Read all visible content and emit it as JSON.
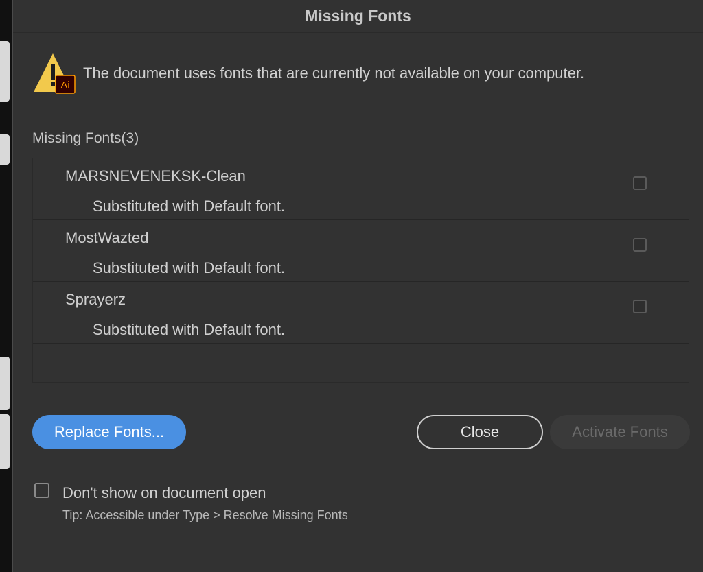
{
  "dialog": {
    "title": "Missing Fonts",
    "message": "The document uses fonts that are currently not available on your computer.",
    "warning_icon": "warning-triangle-with-ai-badge",
    "ai_badge": "Ai"
  },
  "fonts_list": {
    "title": "Missing Fonts(3)",
    "items": [
      {
        "name": "MARSNEVENEKSK-Clean",
        "status": "Substituted with Default font.",
        "checked": false
      },
      {
        "name": "MostWazted",
        "status": "Substituted with Default font.",
        "checked": false
      },
      {
        "name": "Sprayerz",
        "status": "Substituted with Default font.",
        "checked": false
      }
    ]
  },
  "buttons": {
    "replace": "Replace Fonts...",
    "close": "Close",
    "activate": "Activate Fonts"
  },
  "footer": {
    "checkbox_label": "Don't show on document open",
    "tip": "Tip: Accessible under Type > Resolve Missing Fonts"
  },
  "colors": {
    "dialog_bg": "#323232",
    "primary_button": "#4a90e2",
    "warning_yellow": "#f2c94c",
    "ai_badge_bg": "#330000",
    "ai_badge_text": "#ff9a00"
  }
}
